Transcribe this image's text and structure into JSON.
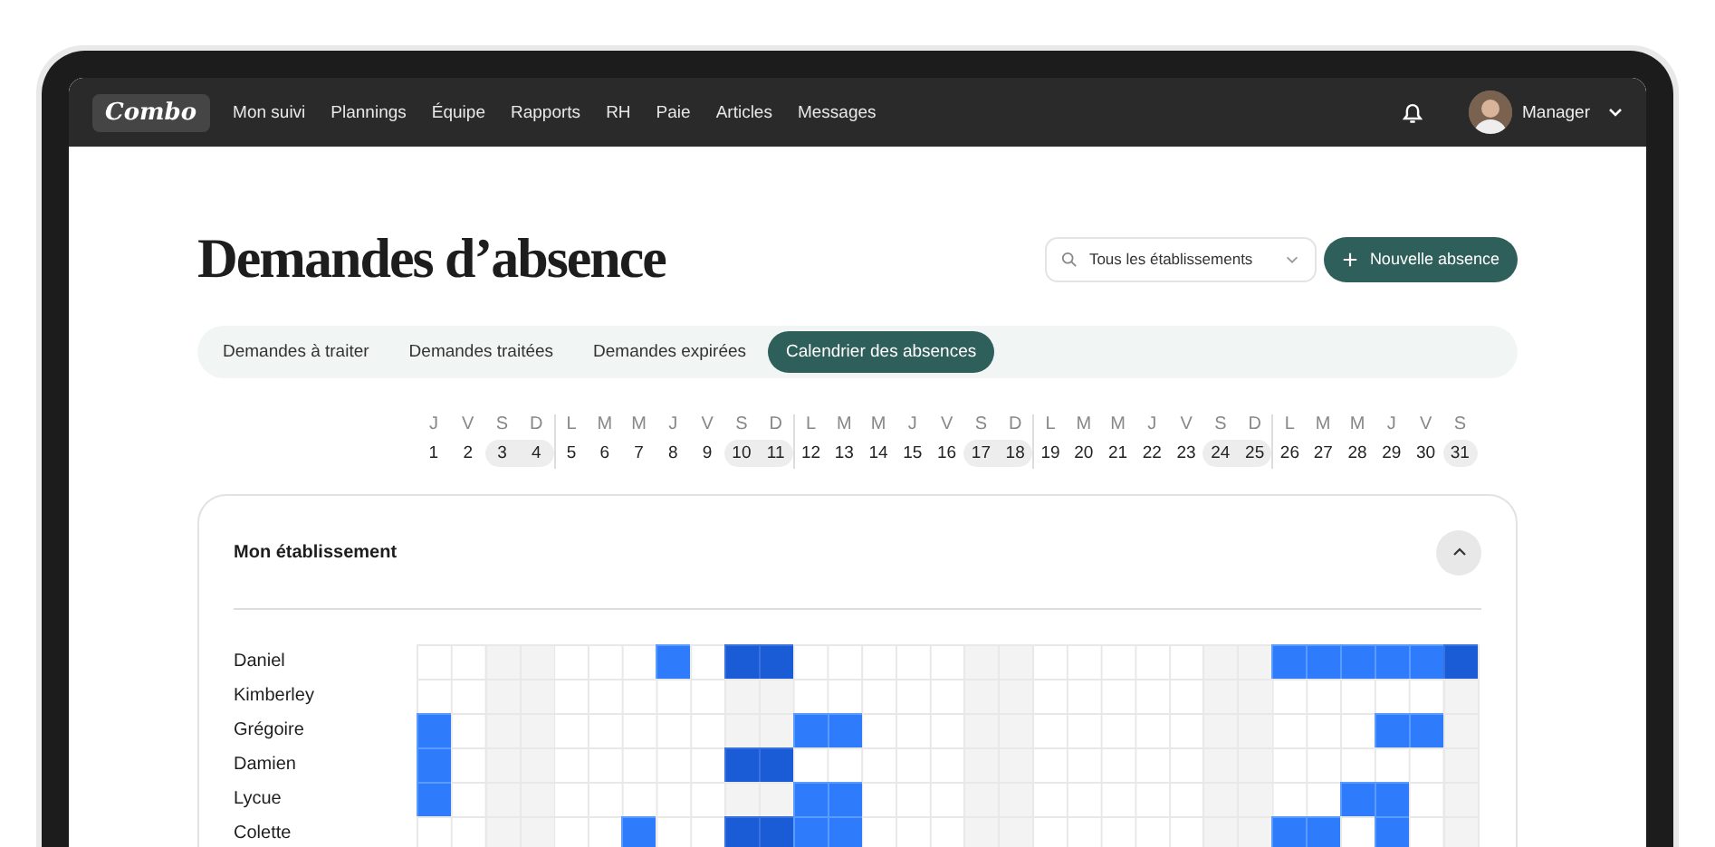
{
  "navbar": {
    "logo": "Combo",
    "items": [
      "Mon suivi",
      "Plannings",
      "Équipe",
      "Rapports",
      "RH",
      "Paie",
      "Articles",
      "Messages"
    ],
    "user": "Manager"
  },
  "title": "Demandes d’absence",
  "filter": {
    "value": "Tous les établissements"
  },
  "new_button": "Nouvelle absence",
  "tabs": [
    {
      "label": "Demandes à traiter",
      "selected": false
    },
    {
      "label": "Demandes traitées",
      "selected": false
    },
    {
      "label": "Demandes expirées",
      "selected": false
    },
    {
      "label": "Calendrier des absences",
      "selected": true
    }
  ],
  "days": [
    {
      "weekday": "J",
      "date": "1",
      "weekend": false
    },
    {
      "weekday": "V",
      "date": "2",
      "weekend": false
    },
    {
      "weekday": "S",
      "date": "3",
      "weekend": true
    },
    {
      "weekday": "D",
      "date": "4",
      "weekend": true
    },
    {
      "weekday": "L",
      "date": "5",
      "weekend": false
    },
    {
      "weekday": "M",
      "date": "6",
      "weekend": false
    },
    {
      "weekday": "M",
      "date": "7",
      "weekend": false
    },
    {
      "weekday": "J",
      "date": "8",
      "weekend": false
    },
    {
      "weekday": "V",
      "date": "9",
      "weekend": false
    },
    {
      "weekday": "S",
      "date": "10",
      "weekend": true
    },
    {
      "weekday": "D",
      "date": "11",
      "weekend": true
    },
    {
      "weekday": "L",
      "date": "12",
      "weekend": false
    },
    {
      "weekday": "M",
      "date": "13",
      "weekend": false
    },
    {
      "weekday": "M",
      "date": "14",
      "weekend": false
    },
    {
      "weekday": "J",
      "date": "15",
      "weekend": false
    },
    {
      "weekday": "V",
      "date": "16",
      "weekend": false
    },
    {
      "weekday": "S",
      "date": "17",
      "weekend": true
    },
    {
      "weekday": "D",
      "date": "18",
      "weekend": true
    },
    {
      "weekday": "L",
      "date": "19",
      "weekend": false
    },
    {
      "weekday": "M",
      "date": "20",
      "weekend": false
    },
    {
      "weekday": "M",
      "date": "21",
      "weekend": false
    },
    {
      "weekday": "J",
      "date": "22",
      "weekend": false
    },
    {
      "weekday": "V",
      "date": "23",
      "weekend": false
    },
    {
      "weekday": "S",
      "date": "24",
      "weekend": true
    },
    {
      "weekday": "D",
      "date": "25",
      "weekend": true
    },
    {
      "weekday": "L",
      "date": "26",
      "weekend": false
    },
    {
      "weekday": "M",
      "date": "27",
      "weekend": false
    },
    {
      "weekday": "M",
      "date": "28",
      "weekend": false
    },
    {
      "weekday": "J",
      "date": "29",
      "weekend": false
    },
    {
      "weekday": "V",
      "date": "30",
      "weekend": false
    },
    {
      "weekday": "S",
      "date": "31",
      "weekend": true
    }
  ],
  "section": {
    "title": "Mon établissement",
    "expanded": true,
    "employees": [
      {
        "name": "Daniel",
        "absent": [
          false,
          false,
          false,
          false,
          false,
          false,
          false,
          true,
          false,
          true,
          true,
          false,
          false,
          false,
          false,
          false,
          false,
          false,
          false,
          false,
          false,
          false,
          false,
          false,
          false,
          true,
          true,
          true,
          true,
          true,
          true
        ]
      },
      {
        "name": "Kimberley",
        "absent": [
          false,
          false,
          false,
          false,
          false,
          false,
          false,
          false,
          false,
          false,
          false,
          false,
          false,
          false,
          false,
          false,
          false,
          false,
          false,
          false,
          false,
          false,
          false,
          false,
          false,
          false,
          false,
          false,
          false,
          false,
          false
        ]
      },
      {
        "name": "Grégoire",
        "absent": [
          true,
          false,
          false,
          false,
          false,
          false,
          false,
          false,
          false,
          false,
          false,
          true,
          true,
          false,
          false,
          false,
          false,
          false,
          false,
          false,
          false,
          false,
          false,
          false,
          false,
          false,
          false,
          false,
          true,
          true,
          false
        ]
      },
      {
        "name": "Damien",
        "absent": [
          true,
          false,
          false,
          false,
          false,
          false,
          false,
          false,
          false,
          true,
          true,
          false,
          false,
          false,
          false,
          false,
          false,
          false,
          false,
          false,
          false,
          false,
          false,
          false,
          false,
          false,
          false,
          false,
          false,
          false,
          false
        ]
      },
      {
        "name": "Lycue",
        "absent": [
          true,
          false,
          false,
          false,
          false,
          false,
          false,
          false,
          false,
          false,
          false,
          true,
          true,
          false,
          false,
          false,
          false,
          false,
          false,
          false,
          false,
          false,
          false,
          false,
          false,
          false,
          false,
          true,
          true,
          false,
          false
        ]
      },
      {
        "name": "Colette",
        "absent": [
          false,
          false,
          false,
          false,
          false,
          false,
          true,
          false,
          false,
          true,
          true,
          true,
          true,
          false,
          false,
          false,
          false,
          false,
          false,
          false,
          false,
          false,
          false,
          false,
          false,
          true,
          true,
          false,
          true,
          false,
          false
        ]
      }
    ]
  }
}
